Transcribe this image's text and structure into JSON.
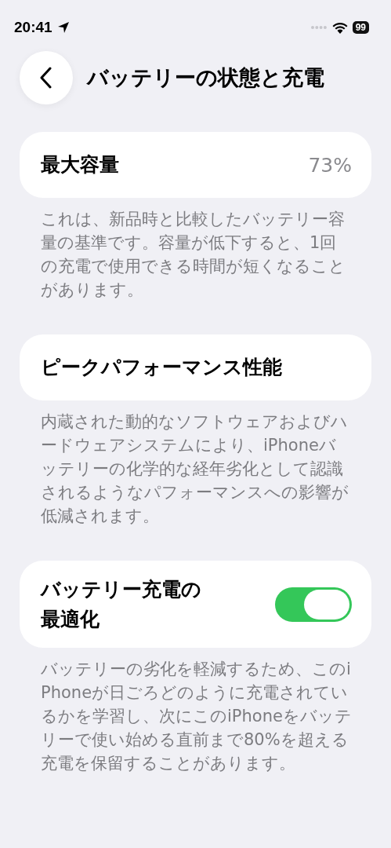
{
  "status_bar": {
    "time": "20:41",
    "battery": "99"
  },
  "header": {
    "title": "バッテリーの状態と充電"
  },
  "sections": [
    {
      "kind": "value",
      "label": "最大容量",
      "value": "73%",
      "description": "これは、新品時と比較したバッテリー容量の基準です。容量が低下すると、1回の充電で使用できる時間が短くなることがあります。"
    },
    {
      "kind": "plain",
      "label": "ピークパフォーマンス性能",
      "description": "内蔵された動的なソフトウェアおよびハードウェアシステムにより、iPhoneバッテリーの化学的な経年劣化として認識されるようなパフォーマンスへの影響が低減されます。"
    },
    {
      "kind": "toggle",
      "label": "バッテリー充電の最適化",
      "on": true,
      "description": "バッテリーの劣化を軽減するため、このiPhoneが日ごろどのように充電されているかを学習し、次にこのiPhoneをバッテリーで使い始める直前まで80%を超える充電を保留することがあります。"
    }
  ]
}
